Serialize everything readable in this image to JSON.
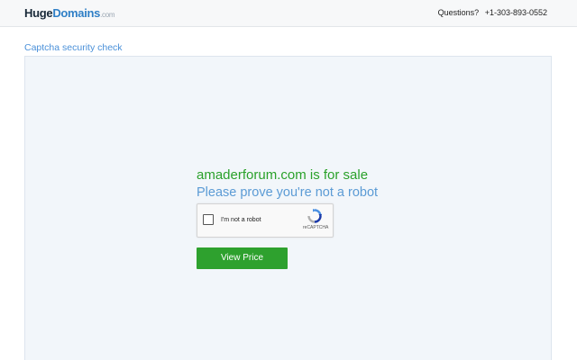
{
  "header": {
    "logo_huge": "Huge",
    "logo_domains": "Domains",
    "logo_tld": ".com",
    "questions_label": "Questions?",
    "phone": "+1-303-893-0552"
  },
  "main": {
    "section_title": "Captcha security check",
    "sale_title": "amaderforum.com is for sale",
    "sale_subtitle": "Please prove you're not a robot",
    "captcha": {
      "label": "I'm not a robot",
      "brand": "reCAPTCHA",
      "checked": false
    },
    "view_price_label": "View Price"
  },
  "colors": {
    "sale_green": "#2aa12a",
    "subtitle_blue": "#5b9bd5",
    "button_green": "#2ea12e",
    "panel_bg": "#f2f6fa"
  }
}
